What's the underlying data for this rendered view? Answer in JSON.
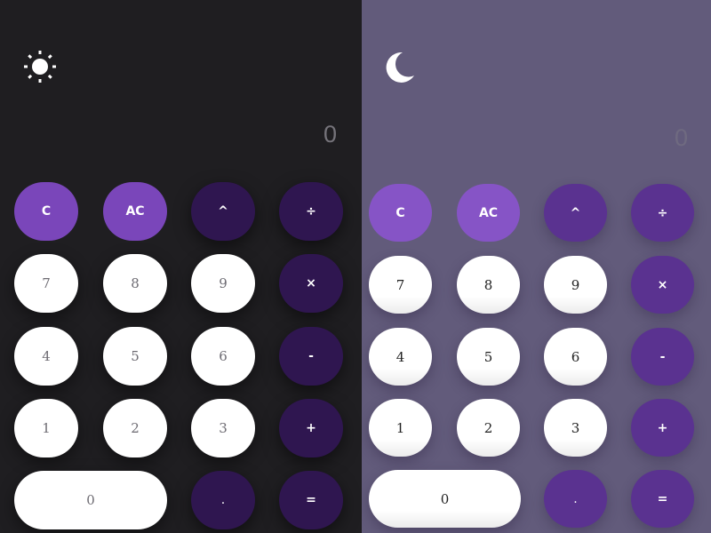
{
  "panels": {
    "dark": {
      "theme_icon": "sun-icon",
      "display": "0",
      "keys": {
        "clear": "C",
        "all_clear": "AC",
        "power": "^",
        "divide": "÷",
        "seven": "7",
        "eight": "8",
        "nine": "9",
        "multiply": "×",
        "four": "4",
        "five": "5",
        "six": "6",
        "minus": "-",
        "one": "1",
        "two": "2",
        "three": "3",
        "plus": "+",
        "zero": "0",
        "decimal": ".",
        "equals": "="
      }
    },
    "light": {
      "theme_icon": "moon-icon",
      "display": "0",
      "keys": {
        "clear": "C",
        "all_clear": "AC",
        "power": "^",
        "divide": "÷",
        "seven": "7",
        "eight": "8",
        "nine": "9",
        "multiply": "×",
        "four": "4",
        "five": "5",
        "six": "6",
        "minus": "-",
        "one": "1",
        "two": "2",
        "three": "3",
        "plus": "+",
        "zero": "0",
        "decimal": ".",
        "equals": "="
      }
    }
  },
  "colors": {
    "dark_background": "#1f1e21",
    "light_background": "#625b7b",
    "accent_dark": "#7a46ba",
    "accent_light": "#8654c6",
    "operator_dark": "#2f1650",
    "operator_light": "#5a3290",
    "number_key": "#ffffff"
  }
}
